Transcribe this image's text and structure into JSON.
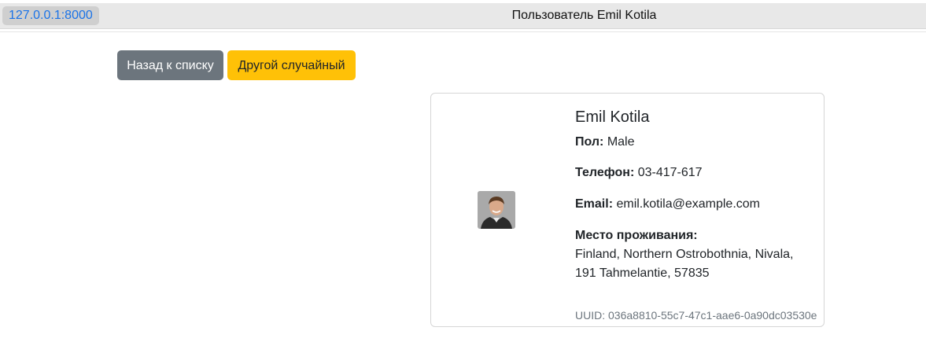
{
  "browser": {
    "url": "127.0.0.1:8000",
    "title": "Пользователь Emil Kotila"
  },
  "toolbar": {
    "back_label": "Назад к списку",
    "random_label": "Другой случайный"
  },
  "user": {
    "name": "Emil Kotila",
    "gender_label": "Пол:",
    "gender": "Male",
    "phone_label": "Телефон:",
    "phone": "03-417-617",
    "email_label": "Email:",
    "email": "emil.kotila@example.com",
    "location_label": "Место проживания:",
    "location_line1": "Finland, Northern Ostrobothnia, Nivala,",
    "location_line2": "191 Tahmelantie, 57835",
    "uuid_label": "UUID:",
    "uuid": "036a8810-55c7-47c1-aae6-0a90dc03530e"
  },
  "colors": {
    "back_button": "#6c757d",
    "random_button": "#ffc107",
    "url_text": "#1a73e8"
  }
}
